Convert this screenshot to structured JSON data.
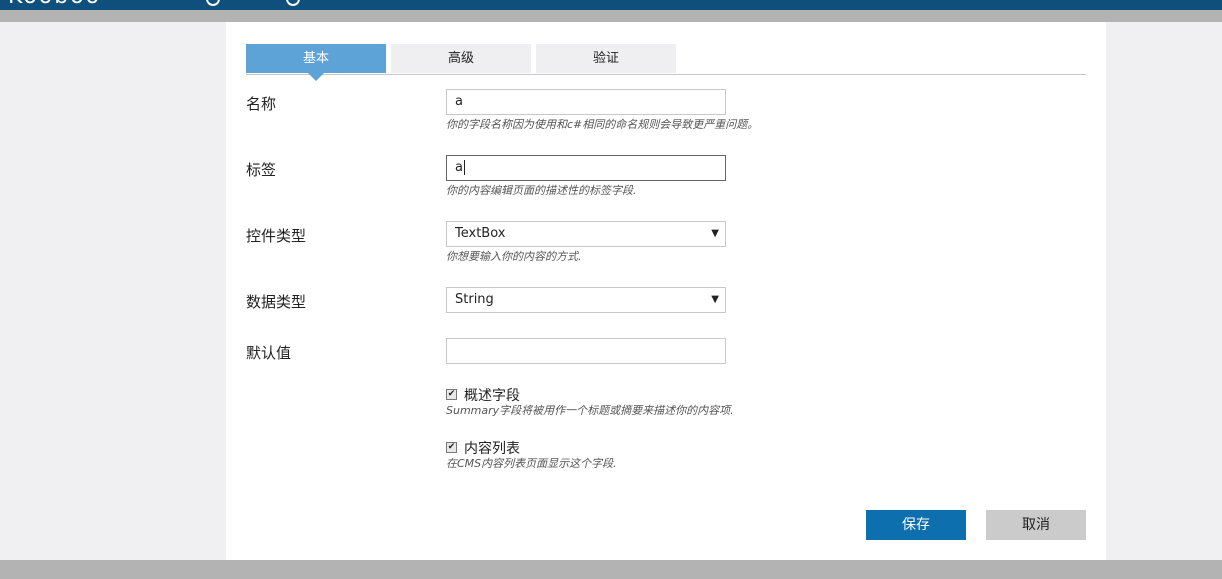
{
  "header": {
    "logo_text": "Kooboo"
  },
  "tabs": [
    {
      "label": "基本"
    },
    {
      "label": "高级"
    },
    {
      "label": "验证"
    }
  ],
  "form": {
    "name": {
      "label": "名称",
      "value": "a",
      "hint": "你的字段名称因为使用和c#相同的命名规则会导致更严重问题。"
    },
    "tag": {
      "label": "标签",
      "value": "a",
      "hint": "你的内容编辑页面的描述性的标签字段."
    },
    "control_type": {
      "label": "控件类型",
      "value": "TextBox",
      "hint": "你想要输入你的内容的方式."
    },
    "data_type": {
      "label": "数据类型",
      "value": "String"
    },
    "default_value": {
      "label": "默认值",
      "value": ""
    },
    "summary_field": {
      "label": "概述字段",
      "checked": true,
      "hint": "Summary字段将被用作一个标题或摘要来描述你的内容项."
    },
    "content_list": {
      "label": "内容列表",
      "checked": true,
      "hint": "在CMS内容列表页面显示这个字段."
    }
  },
  "actions": {
    "save_label": "保存",
    "cancel_label": "取消"
  },
  "colors": {
    "accent": "#5ea3d8",
    "primary_button": "#0e6fae",
    "header": "#0e4f7c"
  }
}
